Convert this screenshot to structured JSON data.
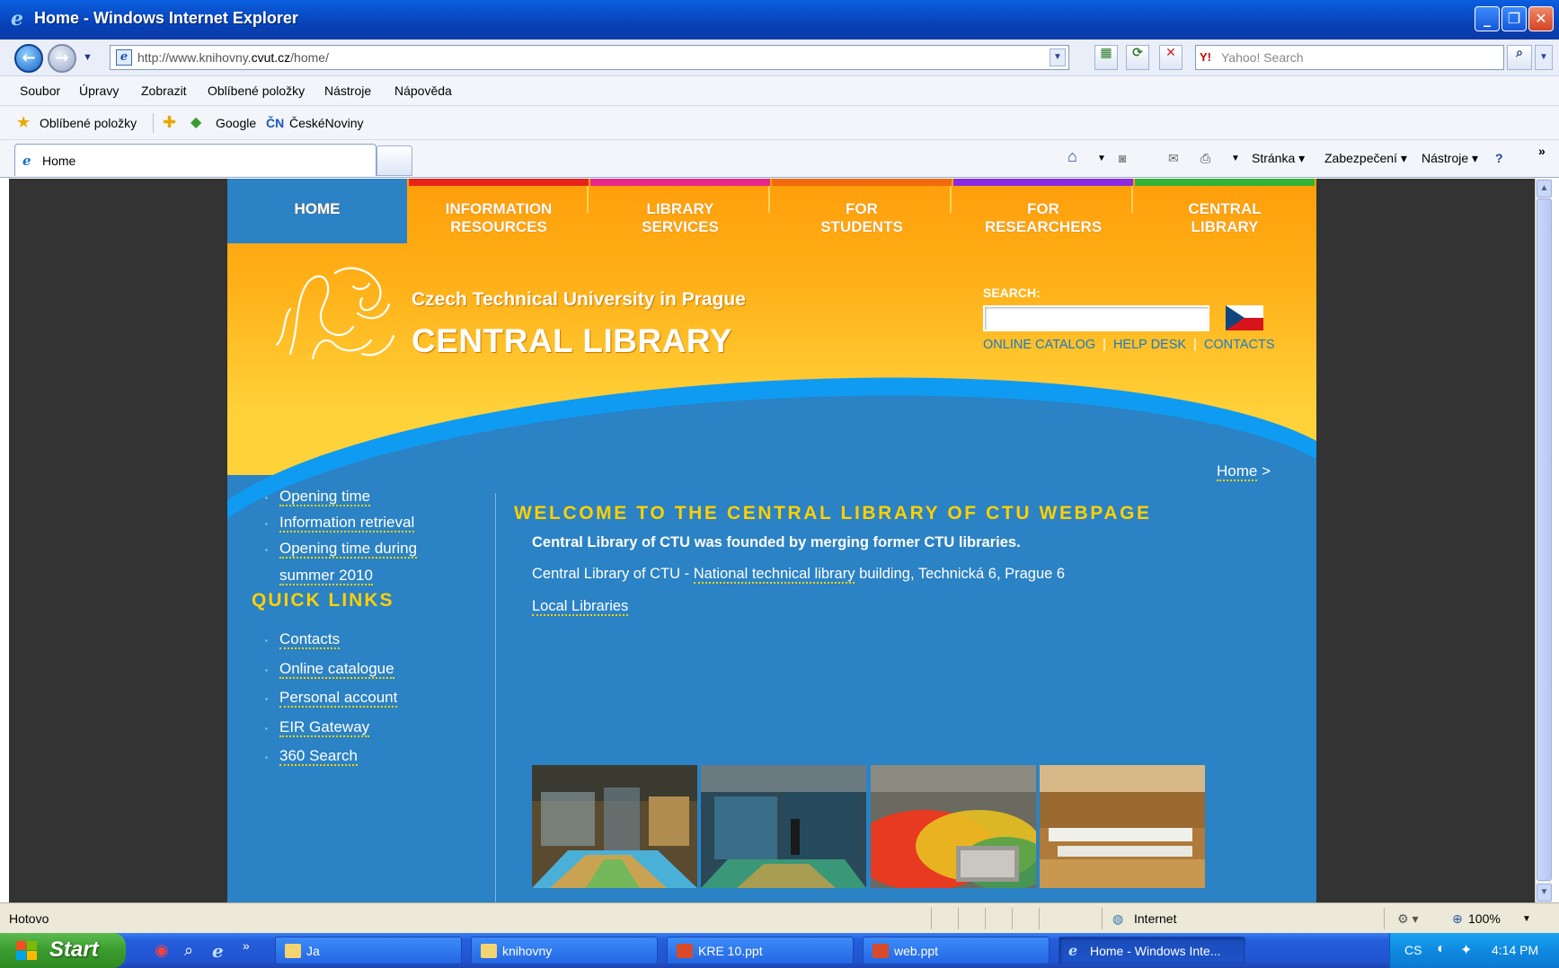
{
  "window": {
    "title": "Home - Windows Internet Explorer",
    "minimize": "_",
    "maximize": "❐",
    "close": "✕"
  },
  "address": {
    "url_prefix": "http://www.knihovny.",
    "url_domain": "cvut.cz",
    "url_suffix": "/home/",
    "search_placeholder": "Yahoo! Search",
    "yahoo_logo": "Y!"
  },
  "menu": [
    "Soubor",
    "Úpravy",
    "Zobrazit",
    "Oblíbené položky",
    "Nástroje",
    "Nápověda"
  ],
  "favorites": {
    "label": "Oblíbené položky",
    "google": "Google",
    "cn_logo": "ČN",
    "ceskenoviny": "ČeskéNoviny"
  },
  "tabs": {
    "active": "Home"
  },
  "commandbar": {
    "stranka": "Stránka ▾",
    "zabezpeceni": "Zabezpečení ▾",
    "nastroje": "Nástroje ▾",
    "more": "»"
  },
  "site": {
    "nav": [
      {
        "line1": "HOME",
        "line2": "",
        "color": "#2b82c4"
      },
      {
        "line1": "INFORMATION",
        "line2": "RESOURCES",
        "color": "#e8231c"
      },
      {
        "line1": "LIBRARY",
        "line2": "SERVICES",
        "color": "#e8268a"
      },
      {
        "line1": "FOR",
        "line2": "STUDENTS",
        "color": "#f26a10"
      },
      {
        "line1": "FOR",
        "line2": "RESEARCHERS",
        "color": "#8a2be2"
      },
      {
        "line1": "CENTRAL",
        "line2": "LIBRARY",
        "color": "#34b233"
      }
    ],
    "university": "Czech Technical University in Prague",
    "library": "CENTRAL LIBRARY",
    "search_label": "SEARCH:",
    "quicklinks": [
      "ONLINE CATALOG",
      "HELP DESK",
      "CONTACTS"
    ],
    "side_links": [
      "Opening time",
      "Information retrieval",
      "Opening time during summer 2010"
    ],
    "quick_links_title": "QUICK LINKS",
    "quick_links": [
      "Contacts",
      "Online catalogue",
      "Personal account",
      "EIR Gateway",
      "360 Search"
    ],
    "breadcrumb": "Home",
    "breadcrumb_arrow": ">",
    "welcome": "WELCOME TO THE CENTRAL LIBRARY OF CTU WEBPAGE",
    "founded": "Central Library of CTU was founded by merging former CTU libraries.",
    "building_prefix": "Central Library of CTU - ",
    "building_link": "National technical library",
    "building_suffix": " building,  Technická 6, Prague 6",
    "local_libraries": "Local Libraries"
  },
  "status": {
    "text": "Hotovo",
    "zone": "Internet",
    "zoom": "100%"
  },
  "taskbar": {
    "start": "Start",
    "tasks": [
      "Ja",
      "knihovny",
      "KRE 10.ppt",
      "web.ppt",
      "Home - Windows Inte..."
    ],
    "lang": "CS",
    "time": "4:14 PM"
  }
}
